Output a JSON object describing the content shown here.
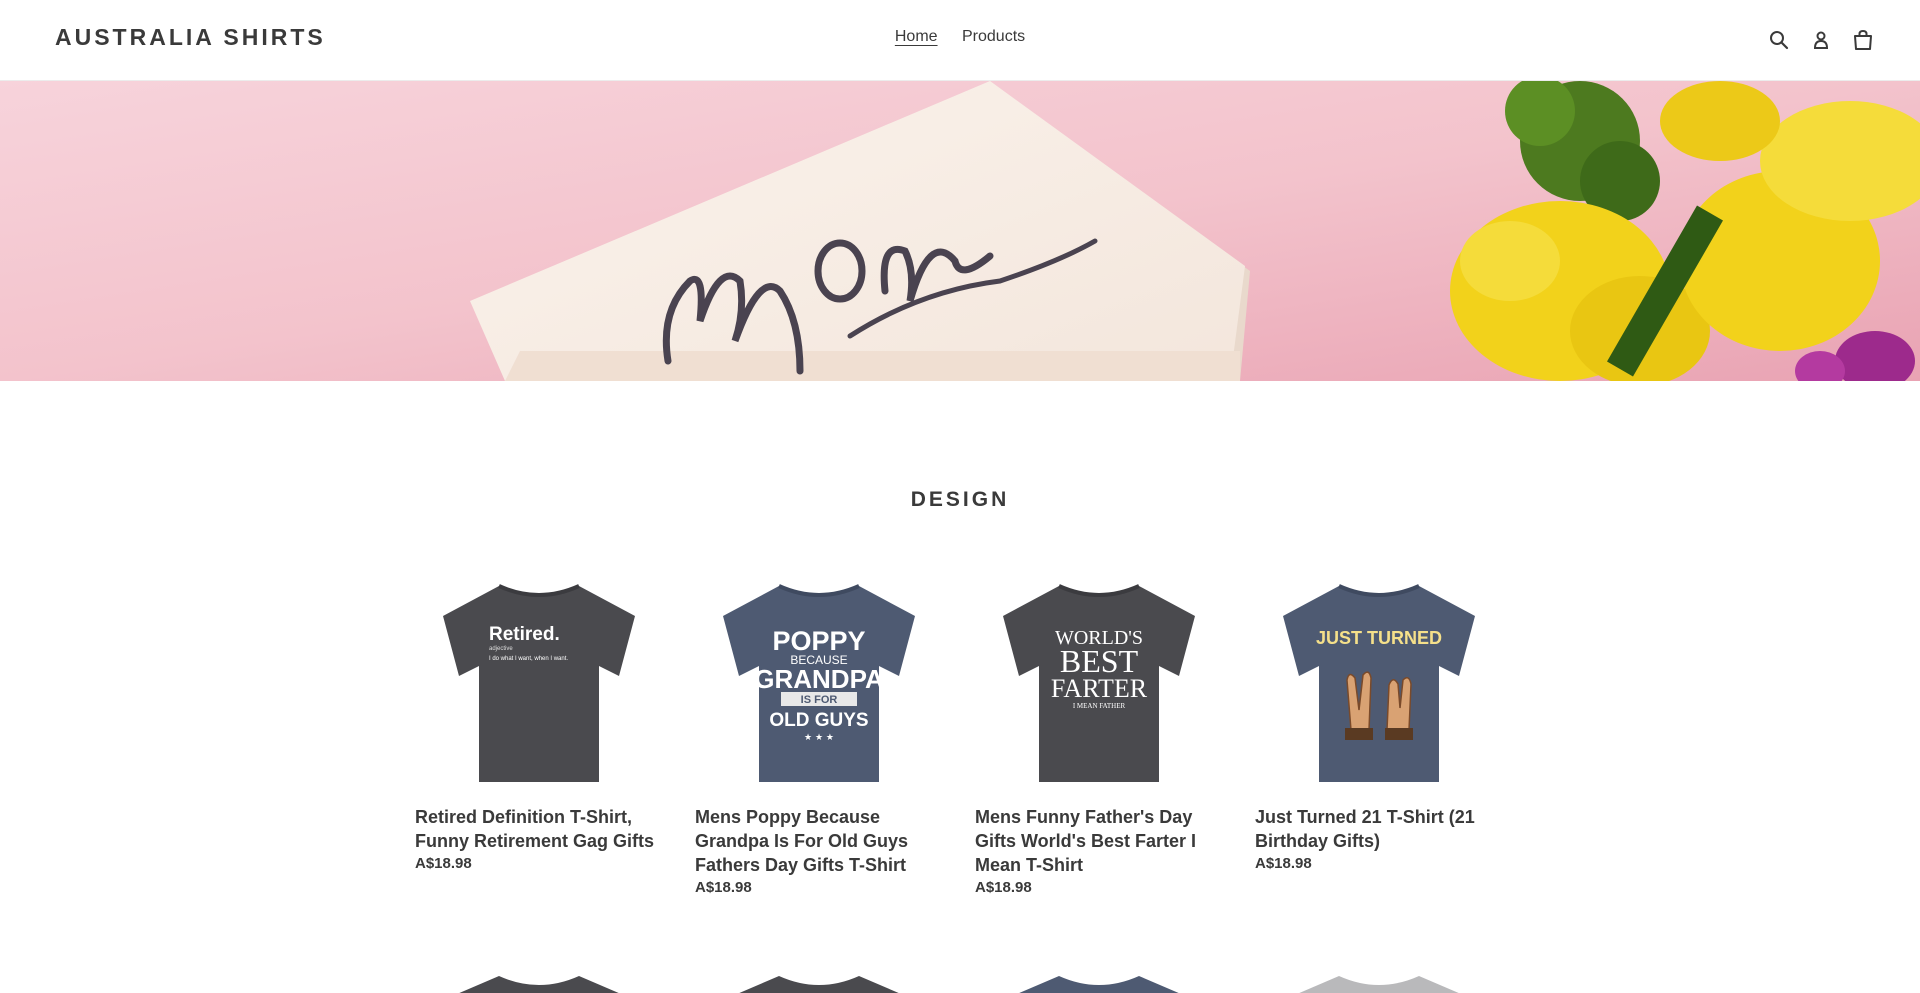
{
  "header": {
    "logo": "AUSTRALIA SHIRTS",
    "nav": [
      {
        "label": "Home",
        "active": true
      },
      {
        "label": "Products",
        "active": false
      }
    ],
    "icons": [
      "search-icon",
      "account-icon",
      "cart-icon"
    ]
  },
  "hero": {
    "card_text": "Mom"
  },
  "section": {
    "title": "DESIGN"
  },
  "products": [
    {
      "title": "Retired Definition T-Shirt, Funny Retirement Gag Gifts",
      "price": "A$18.98",
      "shirt_color": "#4a4a4e",
      "print_lines": [
        "Retired.",
        "adjective",
        "I do what I want, when I want."
      ]
    },
    {
      "title": "Mens Poppy Because Grandpa Is For Old Guys Fathers Day Gifts T-Shirt",
      "price": "A$18.98",
      "shirt_color": "#4e5a72",
      "print_lines": [
        "POPPY",
        "BECAUSE",
        "GRANDPA",
        "IS FOR",
        "OLD GUYS"
      ]
    },
    {
      "title": "Mens Funny Father's Day Gifts World's Best Farter I Mean T-Shirt",
      "price": "A$18.98",
      "shirt_color": "#4a4a4e",
      "print_lines": [
        "WORLD'S",
        "BEST",
        "FARTER",
        "I MEAN FATHER"
      ]
    },
    {
      "title": "Just Turned 21 T-Shirt (21 Birthday Gifts)",
      "price": "A$18.98",
      "shirt_color": "#4e5a72",
      "print_lines": [
        "JUST TURNED"
      ]
    }
  ],
  "next_row_colors": [
    "#4a4a4e",
    "#4a4a4e",
    "#4e5a72",
    "#b9b9bb"
  ],
  "colors": {
    "text": "#3a3a3a",
    "hero_pink": "#f4c9d2",
    "flower_yellow": "#f2d21b",
    "leaf_green": "#4d7a1f"
  }
}
